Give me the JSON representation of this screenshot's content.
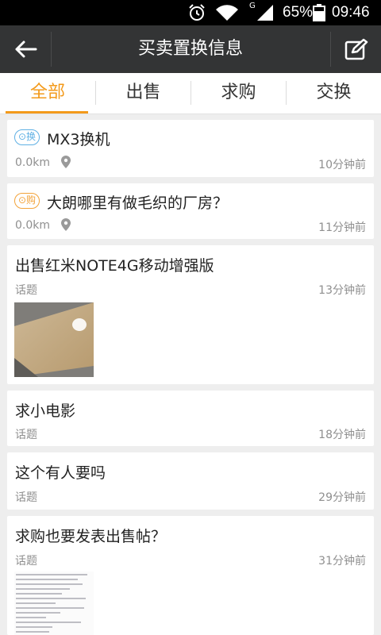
{
  "status_bar": {
    "icons": [
      "alarm-icon",
      "wifi-icon",
      "signal-icon",
      "battery-icon"
    ],
    "network_label": "G",
    "battery_percent": "65%",
    "time": "09:46"
  },
  "title_bar": {
    "title": "买卖置换信息",
    "back_icon": "back-arrow-icon",
    "compose_icon": "compose-icon"
  },
  "tabs": [
    {
      "label": "全部",
      "active": true
    },
    {
      "label": "出售",
      "active": false
    },
    {
      "label": "求购",
      "active": false
    },
    {
      "label": "交换",
      "active": false
    }
  ],
  "colors": {
    "accent": "#f39a1b",
    "title_bar_bg": "#333435",
    "exchange_badge": "#5fb0e4",
    "buy_badge": "#f3a33a",
    "meta_text": "#8f8f8f"
  },
  "posts": [
    {
      "badge": "换",
      "title": "MX3换机",
      "meta": "0.0km",
      "time": "10分钟前"
    },
    {
      "badge": "购",
      "title": "大朗哪里有做毛织的厂房？",
      "meta": "0.0km",
      "time": "11分钟前"
    },
    {
      "title": "出售红米NOTE4G移动增强版",
      "meta": "话题",
      "time": "13分钟前"
    },
    {
      "title": "求小电影",
      "meta": "话题",
      "time": "18分钟前"
    },
    {
      "title": "这个有人要吗",
      "meta": "话题",
      "time": "29分钟前"
    },
    {
      "title": "求购也要发表出售帖？",
      "meta": "话题",
      "time": "31分钟前"
    }
  ]
}
